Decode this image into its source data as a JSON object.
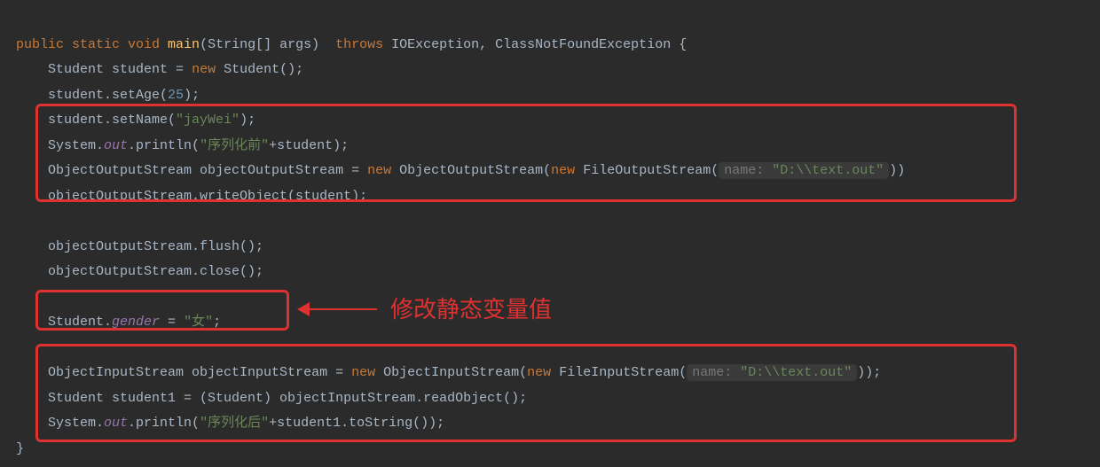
{
  "code": {
    "l1": {
      "kw1": "public static void",
      "name": "main",
      "args": "(String[] args)",
      "throws": "throws",
      "exc": "IOException, ClassNotFoundException {"
    },
    "l2": {
      "type": "Student",
      "var": "student =",
      "kw": "new",
      "ctor": "Student();"
    },
    "l3": "student.setAge(",
    "l3num": "25",
    "l3end": ");",
    "l4a": "student.setName(",
    "l4str": "\"jayWei\"",
    "l4b": ");",
    "l5a": "System.",
    "l5out": "out",
    "l5b": ".println(",
    "l5str": "\"序列化前\"",
    "l5c": "+student);",
    "l6a": "ObjectOutputStream objectOutputStream =",
    "l6new": "new",
    "l6b": "ObjectOutputStream(",
    "l6new2": "new",
    "l6c": "FileOutputStream(",
    "l6hint": "name:",
    "l6str": "\"D:\\\\text.out\"",
    "l6d": "))",
    "l7": "objectOutputStream.writeObject(student);",
    "l8": "objectOutputStream.flush();",
    "l9": "objectOutputStream.close();",
    "l10a": "Student.",
    "l10gender": "gender",
    "l10b": " = ",
    "l10str": "\"女\"",
    "l10c": ";",
    "l11a": "ObjectInputStream objectInputStream =",
    "l11new": "new",
    "l11b": "ObjectInputStream(",
    "l11new2": "new",
    "l11c": "FileInputStream(",
    "l11hint": "name:",
    "l11str": "\"D:\\\\text.out\"",
    "l11d": "));",
    "l12": "Student student1 = (Student) objectInputStream.readObject();",
    "l13a": "System.",
    "l13out": "out",
    "l13b": ".println(",
    "l13str": "\"序列化后\"",
    "l13c": "+student1.toString());"
  },
  "annotation": "修改静态变量值"
}
